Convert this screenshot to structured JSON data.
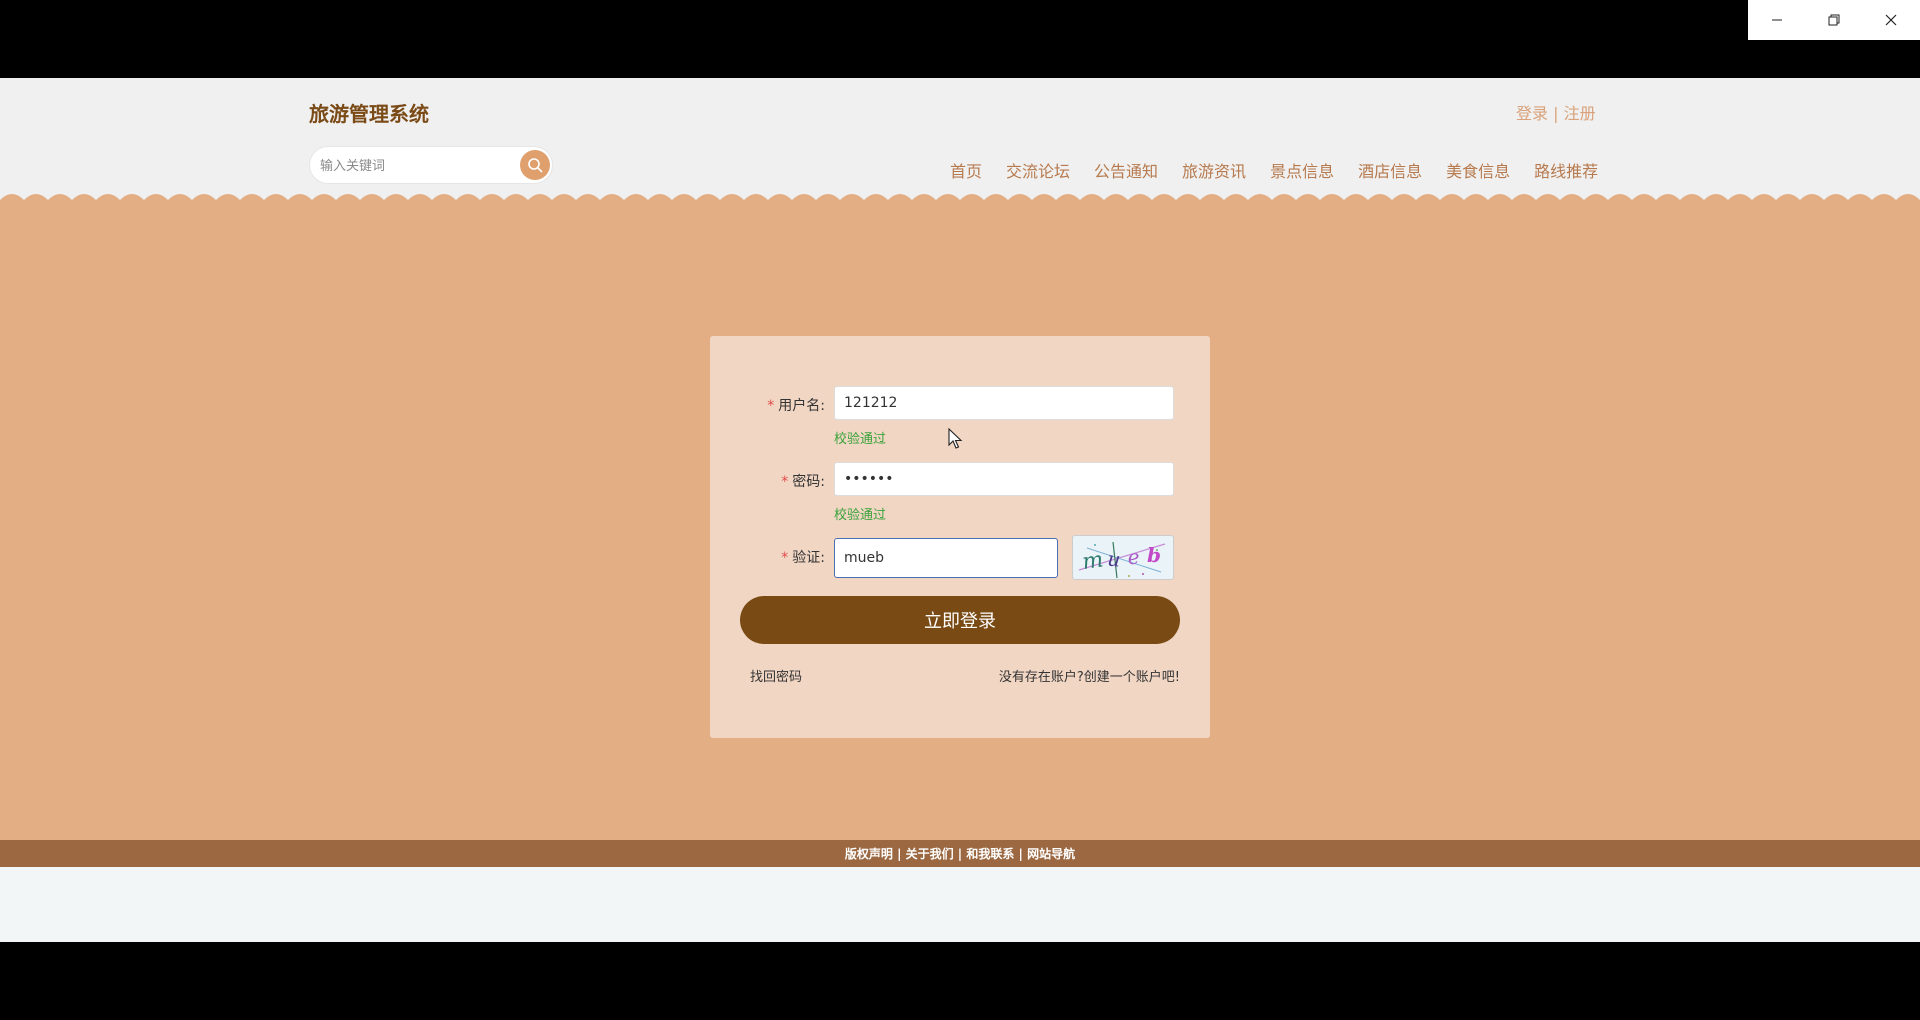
{
  "window": {
    "minimize_icon": "minimize-icon",
    "restore_icon": "restore-icon",
    "close_icon": "close-icon"
  },
  "header": {
    "site_title": "旅游管理系统",
    "login_link": "登录",
    "separator": "|",
    "register_link": "注册",
    "search": {
      "placeholder": "输入关键词",
      "value": "",
      "icon": "search-icon"
    },
    "nav": [
      "首页",
      "交流论坛",
      "公告通知",
      "旅游资讯",
      "景点信息",
      "酒店信息",
      "美食信息",
      "路线推荐"
    ]
  },
  "login_form": {
    "username": {
      "required_mark": "*",
      "label": "用户名:",
      "value": "121212",
      "validation": "校验通过"
    },
    "password": {
      "required_mark": "*",
      "label": "密码:",
      "value": "••••••",
      "validation": "校验通过"
    },
    "captcha": {
      "required_mark": "*",
      "label": "验证:",
      "value": "mueb",
      "image_text": "mueb"
    },
    "submit_label": "立即登录",
    "forgot_password": "找回密码",
    "register_prompt": "没有存在账户?创建一个账户吧!"
  },
  "footer": {
    "text": "版权声明 | 关于我们 | 和我联系 | 网站导航"
  },
  "colors": {
    "header_bg": "#f0f0f0",
    "main_bg": "#e4ae85",
    "card_bg": "#f1d6c4",
    "button": "#7a4a15",
    "nav_text": "#b77a4e",
    "footer_bg": "#9b6842",
    "success": "#3aa33a"
  }
}
